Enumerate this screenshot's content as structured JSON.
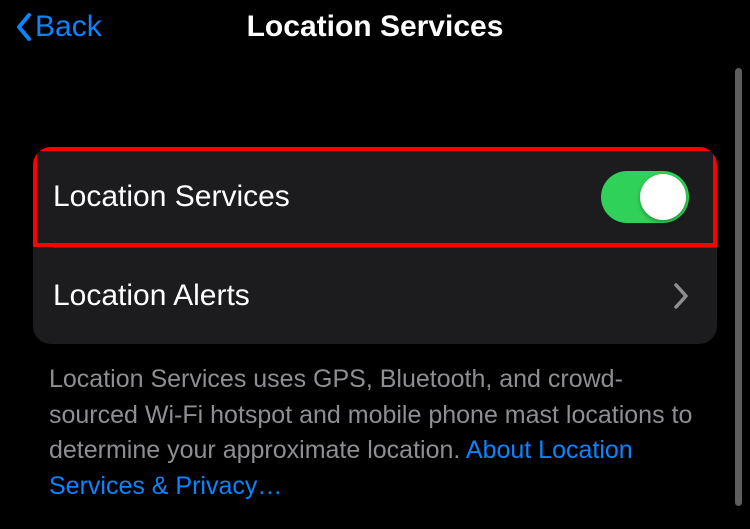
{
  "nav": {
    "back_label": "Back",
    "title": "Location Services"
  },
  "rows": {
    "location_services": {
      "label": "Location Services",
      "toggle_on": true
    },
    "location_alerts": {
      "label": "Location Alerts"
    }
  },
  "footer": {
    "text": "Location Services uses GPS, Bluetooth, and crowd-sourced Wi-Fi hotspot and mobile phone mast locations to determine your approximate location.",
    "link": "About Location Services & Privacy…"
  },
  "colors": {
    "accent": "#0a84ff",
    "toggle_on": "#30d158",
    "highlight": "#ff0000"
  }
}
